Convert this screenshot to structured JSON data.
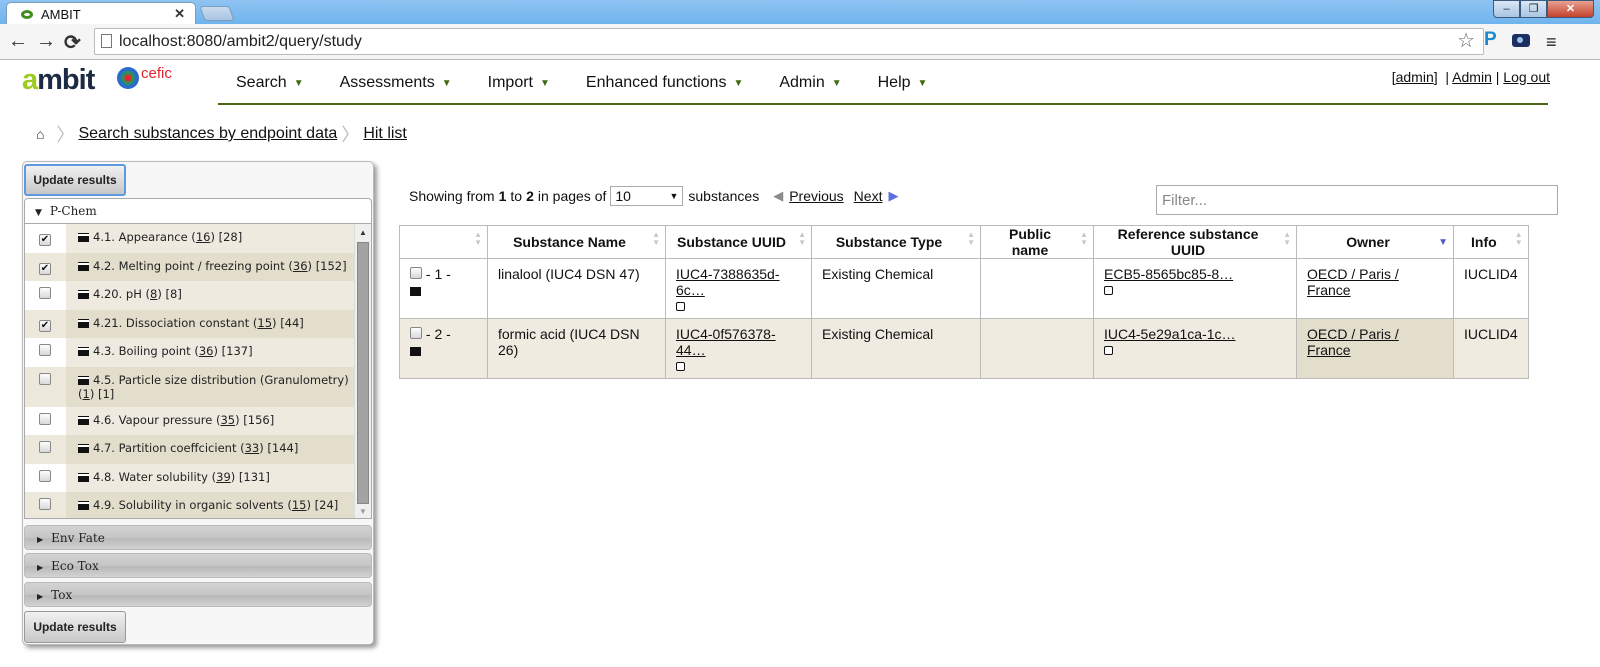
{
  "browser": {
    "tab_title": "AMBIT",
    "url": "localhost:8080/ambit2/query/study",
    "window_buttons": {
      "minimize": "–",
      "restore": "❐",
      "close": "✕"
    },
    "nav": {
      "back": "←",
      "forward": "→",
      "reload": "⟳"
    },
    "extensions": {
      "p": "P"
    },
    "menu_glyph": "≡",
    "star_glyph": "☆"
  },
  "header": {
    "logo": {
      "a": "a",
      "mbit": "mbit",
      "partner": "cefic"
    },
    "nav": [
      {
        "label": "Search"
      },
      {
        "label": "Assessments"
      },
      {
        "label": "Import"
      },
      {
        "label": "Enhanced functions"
      },
      {
        "label": "Admin"
      },
      {
        "label": "Help"
      }
    ],
    "caret": "▼",
    "user": {
      "bracket_open": "[",
      "username": "admin",
      "bracket_close": "]",
      "sep1": "  | ",
      "admin_link": "Admin",
      "sep2": " | ",
      "logout": "Log out"
    }
  },
  "breadcrumb": {
    "home_glyph": "⌂",
    "sep": "〉",
    "items": [
      {
        "label": "Search substances by endpoint data"
      },
      {
        "label": "Hit list"
      }
    ]
  },
  "left_panel": {
    "update_button": "Update results",
    "sections": [
      {
        "label": "P-Chem",
        "expanded": true,
        "glyph": "▼"
      },
      {
        "label": "Env Fate",
        "expanded": false,
        "glyph": "▶"
      },
      {
        "label": "Eco Tox",
        "expanded": false,
        "glyph": "▶"
      },
      {
        "label": "Tox",
        "expanded": false,
        "glyph": "▶"
      }
    ],
    "endpoints": [
      {
        "name": "4.1. Appearance",
        "count": "16",
        "total": "[28]",
        "checked": true
      },
      {
        "name": "4.2. Melting point / freezing point",
        "count": "36",
        "total": "[152]",
        "checked": true
      },
      {
        "name": "4.20. pH",
        "count": "8",
        "total": "[8]",
        "checked": false
      },
      {
        "name": "4.21. Dissociation constant",
        "count": "15",
        "total": "[44]",
        "checked": true
      },
      {
        "name": "4.3. Boiling point",
        "count": "36",
        "total": "[137]",
        "checked": false
      },
      {
        "name": "4.5. Particle size distribution (Granulometry)",
        "count": "1",
        "total": "[1]",
        "checked": false
      },
      {
        "name": "4.6. Vapour pressure",
        "count": "35",
        "total": "[156]",
        "checked": false
      },
      {
        "name": "4.7. Partition coeffcicient",
        "count": "33",
        "total": "[144]",
        "checked": false
      },
      {
        "name": "4.8. Water solubility",
        "count": "39",
        "total": "[131]",
        "checked": false
      },
      {
        "name": "4.9. Solubility in organic solvents",
        "count": "15",
        "total": "[24]",
        "checked": false
      }
    ],
    "check_glyph": "✔"
  },
  "results": {
    "showing_prefix": "Showing from",
    "from": "1",
    "to_word": "to",
    "to": "2",
    "pages_of": "in pages of",
    "page_size": "10",
    "suffix": "substances",
    "previous": "Previous",
    "next": "Next",
    "filter_placeholder": "Filter...",
    "columns": [
      {
        "label": ""
      },
      {
        "label": "Substance Name"
      },
      {
        "label": "Substance UUID"
      },
      {
        "label": "Substance Type"
      },
      {
        "label": "Public name"
      },
      {
        "label": "Reference substance UUID"
      },
      {
        "label": "Owner",
        "sorted": "desc"
      },
      {
        "label": "Info"
      }
    ],
    "rows": [
      {
        "index": "- 1 -",
        "name": "linalool (IUC4 DSN 47)",
        "uuid": "IUC4-7388635d-6c…",
        "type": "Existing Chemical",
        "public_name": "",
        "ref_uuid": "ECB5-8565bc85-8…",
        "owner": "OECD / Paris / France",
        "info": "IUCLID4"
      },
      {
        "index": "- 2 -",
        "name": "formic acid (IUC4 DSN 26)",
        "uuid": "IUC4-0f576378-44…",
        "type": "Existing Chemical",
        "public_name": "",
        "ref_uuid": "IUC4-5e29a1ca-1c…",
        "owner": "OECD / Paris / France",
        "info": "IUCLID4"
      }
    ]
  }
}
